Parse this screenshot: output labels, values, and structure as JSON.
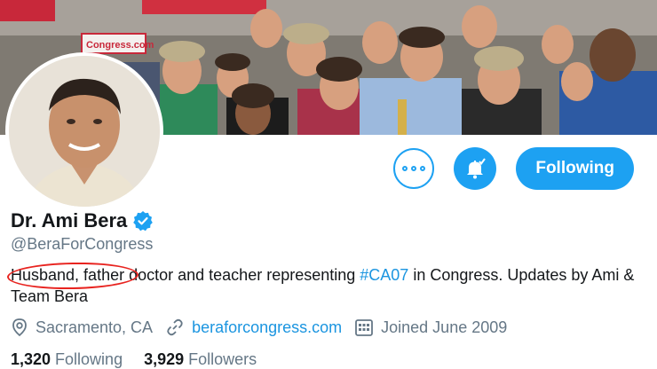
{
  "profile": {
    "name": "Dr. Ami Bera",
    "handle": "@BeraForCongress",
    "bio_part1": "Husband, father",
    "bio_part2": " doctor and teacher representing ",
    "bio_hashtag": "#CA07",
    "bio_part3": " in Congress. Updates by Ami & Team Bera",
    "location": "Sacramento, CA",
    "website": "beraforcongress.com",
    "joined": "Joined June 2009",
    "following_count": "1,320",
    "following_label": "Following",
    "followers_count": "3,929",
    "followers_label": "Followers"
  },
  "banner": {
    "sign_text": "Congress.com"
  },
  "actions": {
    "follow_label": "Following"
  },
  "icons": {
    "verified": "verified-badge-icon",
    "more": "more-options-icon",
    "bell": "notifications-bell-icon",
    "location": "location-pin-icon",
    "link": "link-icon",
    "calendar": "calendar-icon"
  },
  "colors": {
    "accent": "#1da1f2",
    "annotation": "#e8231f"
  }
}
